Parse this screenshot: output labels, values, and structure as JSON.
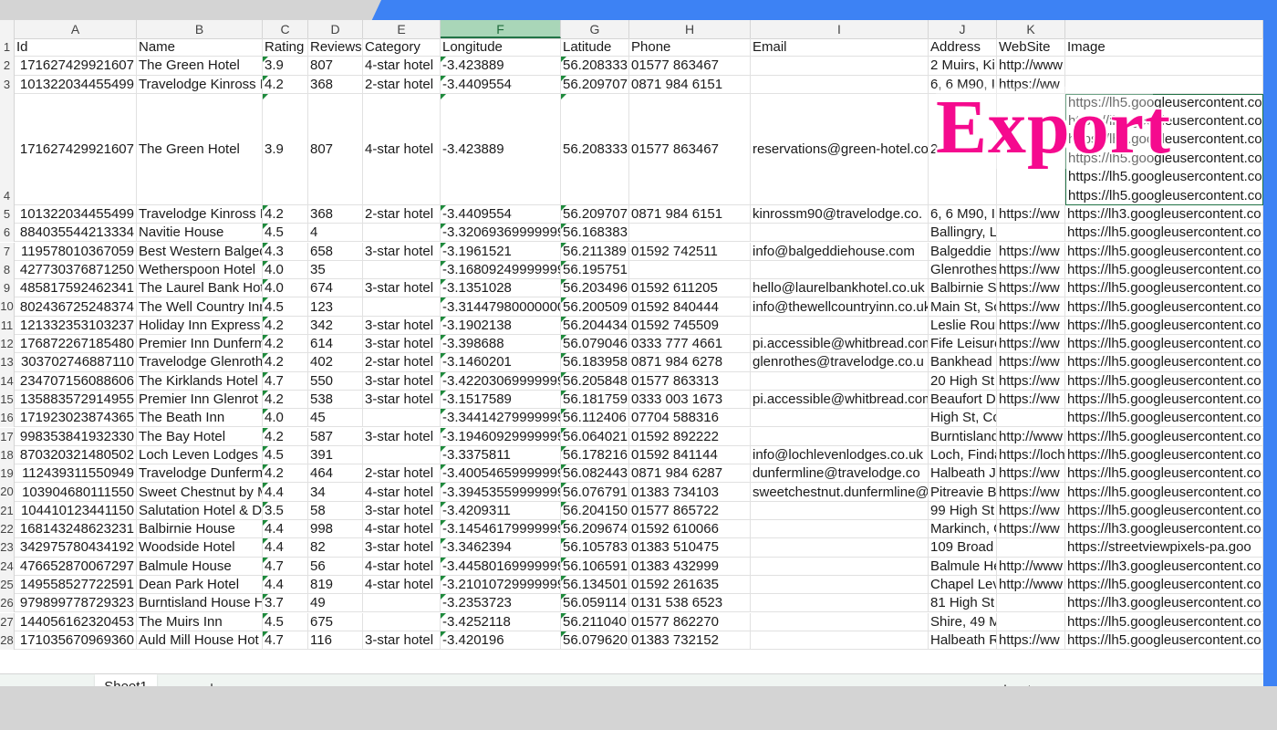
{
  "overlay": {
    "export_label": "Export"
  },
  "columns": [
    {
      "letter": "A"
    },
    {
      "letter": "B"
    },
    {
      "letter": "C"
    },
    {
      "letter": "D"
    },
    {
      "letter": "E"
    },
    {
      "letter": "F",
      "active": true
    },
    {
      "letter": "G"
    },
    {
      "letter": "H"
    },
    {
      "letter": "I"
    },
    {
      "letter": "J"
    },
    {
      "letter": "K"
    },
    {
      "letter": ""
    }
  ],
  "rows": [
    {
      "n": "1",
      "cells": [
        "Id",
        "Name",
        "Rating",
        "Reviews",
        "Category",
        "Longitude",
        "Latitude",
        "Phone",
        "Email",
        "Address",
        "WebSite",
        "Image"
      ]
    },
    {
      "n": "2",
      "cells": [
        "171627429921607",
        "The Green Hotel",
        "3.9",
        "807",
        "4-star hotel",
        "-3.423889",
        "56.208333",
        "01577 863467",
        "",
        "2 Muirs, Ki",
        "http://www",
        ""
      ]
    },
    {
      "n": "3",
      "cells": [
        "101322034455499",
        "Travelodge Kinross M",
        "4.2",
        "368",
        "2-star hotel",
        "-3.4409554",
        "56.209707",
        "0871 984 6151",
        "",
        "6, 6 M90, I",
        "https://ww",
        ""
      ]
    },
    {
      "n": "4",
      "tall": true,
      "cells": [
        "171627429921607",
        "The Green Hotel",
        "3.9",
        "807",
        "4-star hotel",
        "-3.423889",
        "56.208333",
        "01577 863467",
        "reservations@green-hotel.co",
        "2",
        "",
        ""
      ],
      "image_lines": [
        "https://lh5.googleusercontent.co",
        "https://lh3.googleusercontent.co",
        "https://lh3.googleusercontent.co",
        "https://lh5.googleusercontent.co",
        "https://lh5.googleusercontent.co",
        "https://lh5.googleusercontent.co"
      ]
    },
    {
      "n": "5",
      "cells": [
        "101322034455499",
        "Travelodge Kinross M",
        "4.2",
        "368",
        "2-star hotel",
        "-3.4409554",
        "56.209707",
        "0871 984 6151",
        "kinrossm90@travelodge.co.",
        "6, 6 M90, I",
        "https://ww",
        "https://lh3.googleusercontent.co"
      ]
    },
    {
      "n": "6",
      "cells": [
        "884035544213334",
        "Navitie House",
        "4.5",
        "4",
        "",
        "-3.32069369999999",
        "56.168383",
        "",
        "",
        "Ballingry, L",
        "",
        "https://lh5.googleusercontent.co"
      ]
    },
    {
      "n": "7",
      "cells": [
        "119578010367059",
        "Best Western Balged",
        "4.3",
        "658",
        "3-star hotel",
        "-3.1961521",
        "56.211389",
        "01592 742511",
        "info@balgeddiehouse.com",
        "Balgeddie",
        "https://ww",
        "https://lh5.googleusercontent.co"
      ]
    },
    {
      "n": "8",
      "cells": [
        "427730376871250",
        "Wetherspoon Hotel",
        "4.0",
        "35",
        "",
        "-3.16809249999999",
        "56.195751",
        "",
        "",
        "Glenrothes",
        "https://ww",
        "https://lh5.googleusercontent.co"
      ]
    },
    {
      "n": "9",
      "cells": [
        "485817592462341",
        "The Laurel Bank Hot",
        "4.0",
        "674",
        "3-star hotel",
        "-3.1351028",
        "56.203496",
        "01592 611205",
        "hello@laurelbankhotel.co.uk",
        "Balbirnie S",
        "https://ww",
        "https://lh5.googleusercontent.co"
      ]
    },
    {
      "n": "10",
      "cells": [
        "802436725248374",
        "The Well Country Inn",
        "4.5",
        "123",
        "",
        "-3.31447980000000",
        "56.200509",
        "01592 840444",
        "info@thewellcountryinn.co.uk",
        "Main St, Sc",
        "https://ww",
        "https://lh5.googleusercontent.co"
      ]
    },
    {
      "n": "11",
      "cells": [
        "121332353103237",
        "Holiday Inn Express",
        "4.2",
        "342",
        "3-star hotel",
        "-3.1902138",
        "56.204434",
        "01592 745509",
        "",
        "Leslie Rour",
        "https://ww",
        "https://lh5.googleusercontent.co"
      ]
    },
    {
      "n": "12",
      "cells": [
        "176872267185480",
        "Premier Inn Dunferm",
        "4.2",
        "614",
        "3-star hotel",
        "-3.398688",
        "56.079046",
        "0333 777 4661",
        "pi.accessible@whitbread.com",
        "Fife Leisure",
        "https://ww",
        "https://lh5.googleusercontent.co"
      ]
    },
    {
      "n": "13",
      "cells": [
        "303702746887110",
        "Travelodge Glenroth",
        "4.2",
        "402",
        "2-star hotel",
        "-3.1460201",
        "56.183958",
        "0871 984 6278",
        "glenrothes@travelodge.co.u",
        "Bankhead",
        "https://ww",
        "https://lh5.googleusercontent.co"
      ]
    },
    {
      "n": "14",
      "cells": [
        "234707156088606",
        "The Kirklands Hotel",
        "4.7",
        "550",
        "3-star hotel",
        "-3.42203069999999",
        "56.205848",
        "01577 863313",
        "",
        "20 High St",
        "https://ww",
        "https://lh5.googleusercontent.co"
      ]
    },
    {
      "n": "15",
      "cells": [
        "135883572914955",
        "Premier Inn Glenrot",
        "4.2",
        "538",
        "3-star hotel",
        "-3.1517589",
        "56.181759",
        "0333 003 1673",
        "pi.accessible@whitbread.com",
        "Beaufort D",
        "https://ww",
        "https://lh5.googleusercontent.co"
      ]
    },
    {
      "n": "16",
      "cells": [
        "171923023874365",
        "The Beath Inn",
        "4.0",
        "45",
        "",
        "-3.34414279999999",
        "56.112406",
        "07704 588316",
        "",
        "High St, Co",
        "",
        "https://lh5.googleusercontent.co"
      ]
    },
    {
      "n": "17",
      "cells": [
        "998353841932330",
        "The Bay Hotel",
        "4.2",
        "587",
        "3-star hotel",
        "-3.19460929999999",
        "56.064021",
        "01592 892222",
        "",
        "Burntisland",
        "http://www",
        "https://lh5.googleusercontent.co"
      ]
    },
    {
      "n": "18",
      "cells": [
        "870320321480502",
        "Loch Leven Lodges",
        "4.5",
        "391",
        "",
        "-3.3375811",
        "56.178216",
        "01592 841144",
        "info@lochlevenlodges.co.uk",
        "Loch, Finda",
        "https://loch",
        "https://lh5.googleusercontent.co"
      ]
    },
    {
      "n": "19",
      "cells": [
        "112439311550949",
        "Travelodge Dunferm",
        "4.2",
        "464",
        "2-star hotel",
        "-3.40054659999999",
        "56.082443",
        "0871 984 6287",
        "dunfermline@travelodge.co",
        "Halbeath J",
        "https://ww",
        "https://lh5.googleusercontent.co"
      ]
    },
    {
      "n": "20",
      "cells": [
        "103904680111550",
        "Sweet Chestnut by M",
        "4.4",
        "34",
        "4-star hotel",
        "-3.39453559999999",
        "56.076791",
        "01383 734103",
        "sweetchestnut.dunfermline@",
        "Pitreavie Bl",
        "https://ww",
        "https://lh5.googleusercontent.co"
      ]
    },
    {
      "n": "21",
      "cells": [
        "104410123441150",
        "Salutation Hotel & D",
        "3.5",
        "58",
        "3-star hotel",
        "-3.4209311",
        "56.204150",
        "01577 865722",
        "",
        "99 High St",
        "https://ww",
        "https://lh5.googleusercontent.co"
      ]
    },
    {
      "n": "22",
      "cells": [
        "168143248623231",
        "Balbirnie House",
        "4.4",
        "998",
        "4-star hotel",
        "-3.14546179999999",
        "56.209674",
        "01592 610066",
        "",
        "Markinch, G",
        "https://ww",
        "https://lh3.googleusercontent.co"
      ]
    },
    {
      "n": "23",
      "cells": [
        "342975780434192",
        "Woodside Hotel",
        "4.4",
        "82",
        "3-star hotel",
        "-3.3462394",
        "56.105783",
        "01383 510475",
        "",
        "109 Broad",
        "",
        "https://streetviewpixels-pa.goo"
      ]
    },
    {
      "n": "24",
      "cells": [
        "476652870067297",
        "Balmule House",
        "4.7",
        "56",
        "4-star hotel",
        "-3.44580169999999",
        "56.106591",
        "01383 432999",
        "",
        "Balmule He",
        "http://www",
        "https://lh3.googleusercontent.co"
      ]
    },
    {
      "n": "25",
      "cells": [
        "149558527722591",
        "Dean Park Hotel",
        "4.4",
        "819",
        "4-star hotel",
        "-3.21010729999999",
        "56.134501",
        "01592 261635",
        "",
        "Chapel Lev",
        "http://www",
        "https://lh5.googleusercontent.co"
      ]
    },
    {
      "n": "26",
      "cells": [
        "979899778729323",
        "Burntisland House H",
        "3.7",
        "49",
        "",
        "-3.2353723",
        "56.059114",
        "0131 538 6523",
        "",
        "81 High St",
        "",
        "https://lh3.googleusercontent.co"
      ]
    },
    {
      "n": "27",
      "cells": [
        "144056162320453",
        "The Muirs Inn",
        "4.5",
        "675",
        "",
        "-3.4252118",
        "56.211040",
        "01577 862270",
        "",
        "Shire, 49 M",
        "",
        "https://lh5.googleusercontent.co"
      ]
    },
    {
      "n": "28",
      "cells": [
        "171035670969360",
        "Auld Mill House Hot",
        "4.7",
        "116",
        "3-star hotel",
        "-3.420196",
        "56.079620",
        "01383 732152",
        "",
        "Halbeath R",
        "https://ww",
        "https://lh5.googleusercontent.co"
      ]
    }
  ],
  "tabbar": {
    "sheet_tab": "Sheet1",
    "add_sheet": "+",
    "prev": "‹",
    "next": "›",
    "menu": "⋮"
  }
}
